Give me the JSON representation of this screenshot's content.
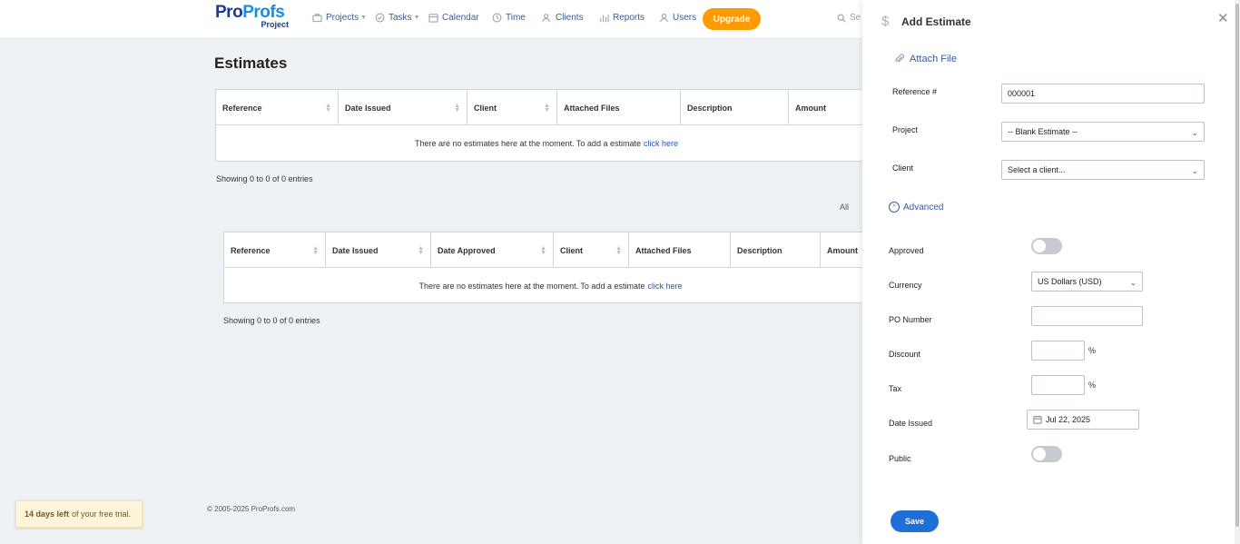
{
  "header": {
    "logo_pro": "Pro",
    "logo_profs": "Profs",
    "logo_sub": "Project",
    "nav": {
      "projects": "Projects",
      "tasks": "Tasks",
      "calendar": "Calendar",
      "time": "Time",
      "clients": "Clients",
      "reports": "Reports",
      "users": "Users"
    },
    "upgrade": "Upgrade",
    "search": "Se"
  },
  "main": {
    "title": "Estimates",
    "table1": {
      "columns": [
        "Reference",
        "Date Issued",
        "Client",
        "Attached Files",
        "Description",
        "Amount"
      ],
      "empty_text": "There are no estimates here at the moment. To add a estimate",
      "empty_link": "click here",
      "showing": "Showing 0 to 0 of 0 entries"
    },
    "filter_all": "All",
    "table2": {
      "columns": [
        "Reference",
        "Date Issued",
        "Date Approved",
        "Client",
        "Attached Files",
        "Description",
        "Amount"
      ],
      "empty_text": "There are no estimates here at the moment. To add a estimate",
      "empty_link": "click here",
      "showing": "Showing 0 to 0 of 0 entries"
    }
  },
  "footer": {
    "copyright": "© 2005-2025 ProProfs.com",
    "trial_bold": "14 days left",
    "trial_rest": "of your free trial."
  },
  "panel": {
    "title": "Add Estimate",
    "attach_file": "Attach File",
    "reference_label": "Reference #",
    "reference_value": "000001",
    "project_label": "Project",
    "project_value": "-- Blank Estimate --",
    "client_label": "Client",
    "client_value": "Select a client...",
    "advanced": "Advanced",
    "approved_label": "Approved",
    "approved_on": false,
    "currency_label": "Currency",
    "currency_value": "US Dollars (USD)",
    "po_label": "PO Number",
    "po_value": "",
    "discount_label": "Discount",
    "discount_value": "",
    "tax_label": "Tax",
    "tax_value": "",
    "percent": "%",
    "date_label": "Date Issued",
    "date_value": "Jul 22, 2025",
    "public_label": "Public",
    "public_on": false,
    "save": "Save"
  }
}
